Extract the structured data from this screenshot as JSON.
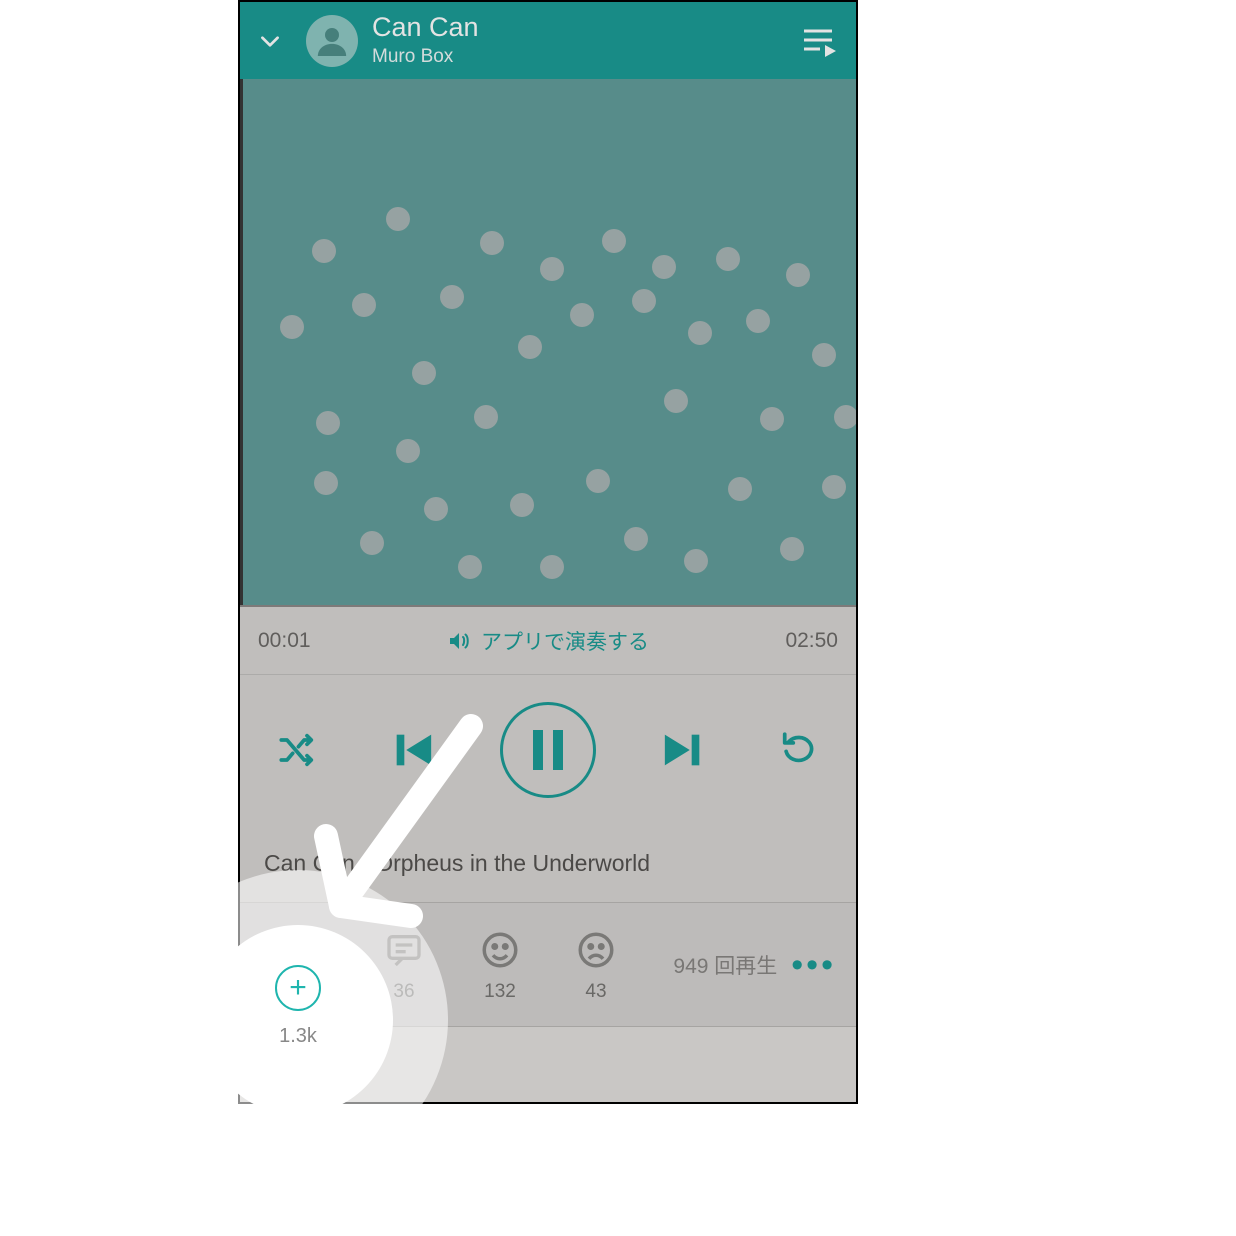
{
  "header": {
    "track_title": "Can Can",
    "artist": "Muro Box"
  },
  "playback": {
    "elapsed": "00:01",
    "duration": "02:50",
    "mode_label": "アプリで演奏する"
  },
  "song": {
    "display_title": "Can Can - Orpheus in the Underworld"
  },
  "stats": {
    "add_count": "1.3k",
    "comments": "36",
    "likes": "132",
    "dislikes": "43",
    "plays_text": "949 回再生"
  }
}
